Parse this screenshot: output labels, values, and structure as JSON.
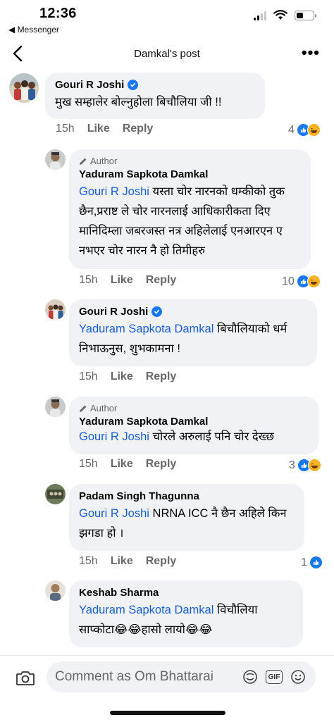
{
  "status": {
    "time": "12:36",
    "back_app": "◀ Messenger"
  },
  "nav": {
    "title": "Damkal's post"
  },
  "comments": [
    {
      "name": "Gouri R Joshi",
      "verified": true,
      "text": "मुख सम्हालेर बोल्नुहोला बिचौलिया जी !!",
      "time": "15h",
      "like": "Like",
      "reply": "Reply",
      "reaction_count": "4"
    },
    {
      "author_tag": "Author",
      "name": "Yaduram Sapkota Damkal",
      "mention": "Gouri R Joshi",
      "text": "  यस्ता चोर नारनको धम्कीको तुक छैन,प्रराष्ट ले चोर नारनलाई आधिकारीकता दिए मानिदिम्ला जबरजस्त नत्र अहिलेलाई एनआरएन ए नभएर चोर नारन नै हो तिमीहरु",
      "time": "15h",
      "like": "Like",
      "reply": "Reply",
      "reaction_count": "10"
    },
    {
      "name": "Gouri R Joshi",
      "verified": true,
      "mention": "Yaduram Sapkota Damkal",
      "text": " बिचौलियाको धर्म निभाऊनुस, शुभकामना !",
      "time": "15h",
      "like": "Like",
      "reply": "Reply"
    },
    {
      "author_tag": "Author",
      "name": "Yaduram Sapkota Damkal",
      "mention": "Gouri R Joshi",
      "text": " चोरले अरुलाई पनि चोर देख्छ",
      "time": "15h",
      "like": "Like",
      "reply": "Reply",
      "reaction_count": "3"
    },
    {
      "name": "Padam Singh Thagunna",
      "mention": "Gouri R Joshi",
      "text": " NRNA ICC नै छैन अहिले किन झगडा हो ।",
      "time": "15h",
      "like": "Like",
      "reply": "Reply",
      "reaction_count": "1"
    },
    {
      "name": "Keshab Sharma",
      "mention": "Yaduram Sapkota Damkal",
      "text": " विचौलिया साप्कोटा😂😂हासो लायो😂😂"
    }
  ],
  "composer": {
    "placeholder": "Comment as Om Bhattarai",
    "gif_label": "GIF"
  },
  "colors": {
    "accent": "#1877f2",
    "mention": "#1a5ed3",
    "bubble": "#f0f2f5",
    "meta": "#65676b"
  }
}
